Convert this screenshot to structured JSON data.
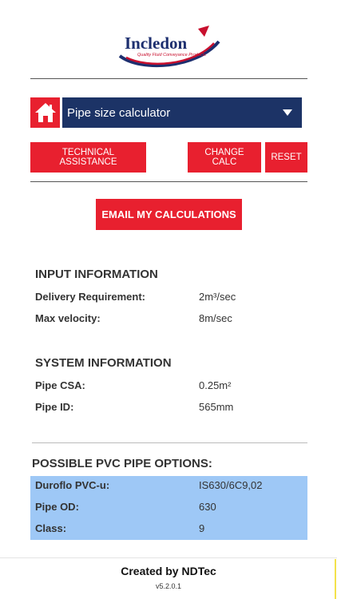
{
  "brand": {
    "name": "Incledon",
    "tagline": "Quality Fluid Conveyance Products",
    "primary_color": "#e8202f",
    "navy_color": "#1c3366"
  },
  "toolbar": {
    "home_icon": "home-icon",
    "calculator_select": "Pipe size calculator",
    "technical_assistance": "TECHNICAL ASSISTANCE",
    "change_calc": "CHANGE CALC",
    "reset": "RESET",
    "email": "EMAIL MY CALCULATIONS"
  },
  "input_info": {
    "title": "INPUT INFORMATION",
    "rows": [
      {
        "label": "Delivery Requirement:",
        "value": "2m³/sec"
      },
      {
        "label": "Max velocity:",
        "value": "8m/sec"
      }
    ]
  },
  "system_info": {
    "title": "SYSTEM INFORMATION",
    "rows": [
      {
        "label": "Pipe CSA:",
        "value": "0.25m²"
      },
      {
        "label": "Pipe ID:",
        "value": "565mm"
      }
    ]
  },
  "pvc_options": {
    "title": "POSSIBLE PVC PIPE OPTIONS:",
    "highlight_color": "#9ec8f6",
    "rows": [
      {
        "label": "Duroflo PVC-u:",
        "value": "IS630/6C9,02"
      },
      {
        "label": "Pipe OD:",
        "value": "630"
      },
      {
        "label": "Class:",
        "value": "9"
      }
    ]
  },
  "footer": {
    "credit": "Created by NDTec",
    "version": "v5.2.0.1"
  }
}
